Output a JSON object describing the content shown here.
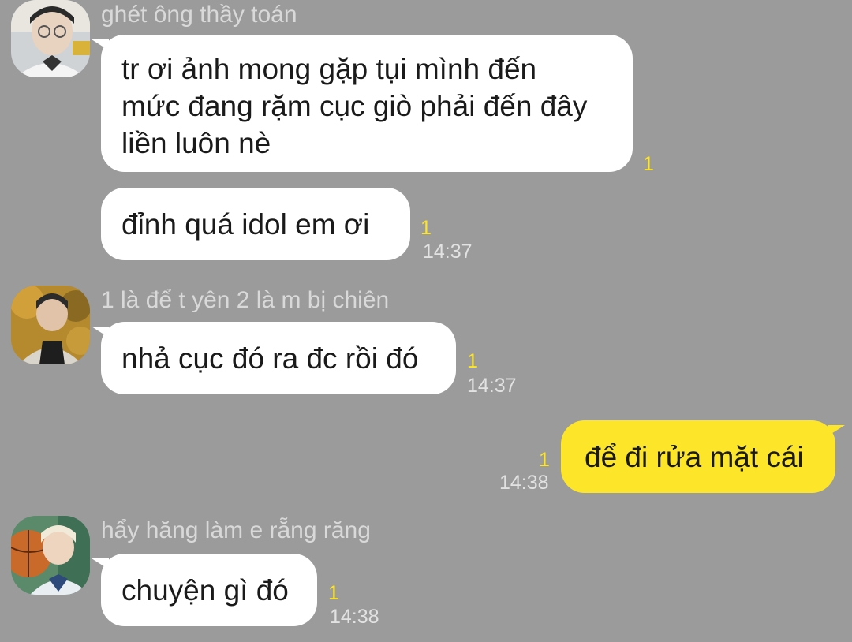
{
  "colors": {
    "background": "#9b9b9b",
    "bubble_incoming": "#ffffff",
    "bubble_outgoing": "#fde52a",
    "unread_count": "#fde52a"
  },
  "messages": {
    "g1": {
      "sender": "ghét ông thầy toán",
      "avatar_icon": "user-avatar-photo",
      "m1": {
        "lines": [
          "tr ơi ảnh mong gặp tụi mình đến",
          "mức đang rặm cục giò phải đến đây",
          "liền luôn nè"
        ],
        "unread": "1"
      },
      "m2": {
        "text": "đỉnh quá idol em ơi",
        "unread": "1",
        "time": "14:37"
      }
    },
    "g2": {
      "sender": "1 là để t yên 2 là m bị chiên",
      "avatar_icon": "user-avatar-photo",
      "m1": {
        "text": "nhả cục đó ra đc rồi đó",
        "unread": "1",
        "time": "14:37"
      }
    },
    "me": {
      "m1": {
        "text": "để đi rửa mặt cái",
        "unread": "1",
        "time": "14:38"
      }
    },
    "g3": {
      "sender": "hẩy hăng làm e rẵng răng",
      "avatar_icon": "user-avatar-photo",
      "m1": {
        "text": "chuyện gì đó",
        "unread": "1",
        "time": "14:38"
      }
    }
  }
}
